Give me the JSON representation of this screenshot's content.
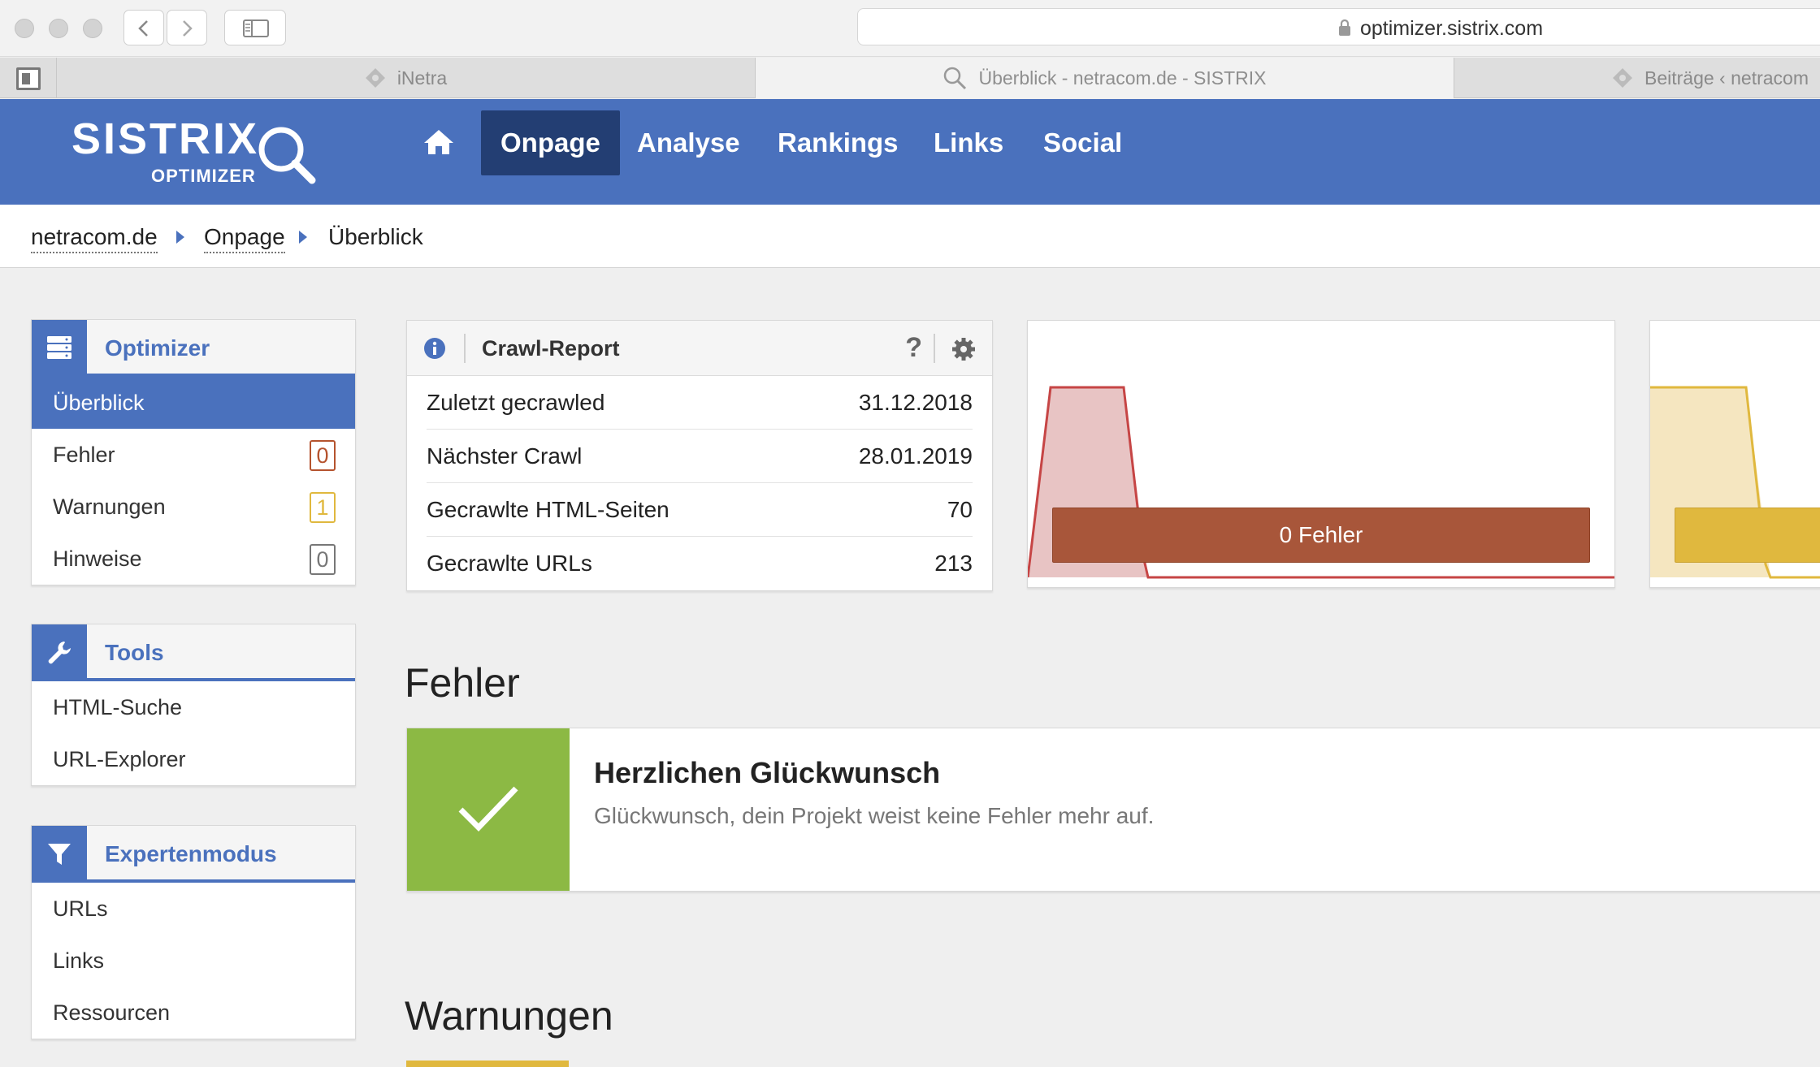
{
  "browser": {
    "url": "optimizer.sistrix.com",
    "tabs": [
      {
        "label": "iNetra",
        "icon": "diamond-favicon-icon"
      },
      {
        "label": "Überblick - netracom.de - SISTRIX",
        "icon": "search-favicon-icon"
      },
      {
        "label": "Beiträge ‹ netracom",
        "icon": "diamond-favicon-icon"
      }
    ]
  },
  "brand": {
    "name": "SISTRIX",
    "sub": "OPTIMIZER",
    "color": "#4a71bd"
  },
  "nav": {
    "home_icon": "home-icon",
    "items": [
      "Onpage",
      "Analyse",
      "Rankings",
      "Links",
      "Social"
    ],
    "active": "Onpage"
  },
  "breadcrumb": [
    "netracom.de",
    "Onpage",
    "Überblick"
  ],
  "sidebar": {
    "optimizer": {
      "title": "Optimizer",
      "icon": "server-icon",
      "items": [
        {
          "label": "Überblick"
        },
        {
          "label": "Fehler",
          "count": "0",
          "color": "#b5532e"
        },
        {
          "label": "Warnungen",
          "count": "1",
          "color": "#e0b83e"
        },
        {
          "label": "Hinweise",
          "count": "0",
          "color": "#777777"
        }
      ]
    },
    "tools": {
      "title": "Tools",
      "icon": "wrench-icon",
      "items": [
        "HTML-Suche",
        "URL-Explorer"
      ]
    },
    "expert": {
      "title": "Expertenmodus",
      "icon": "filter-icon",
      "items": [
        "URLs",
        "Links",
        "Ressourcen"
      ]
    }
  },
  "crawl_report": {
    "title": "Crawl-Report",
    "help": "?",
    "rows": [
      {
        "label": "Zuletzt gecrawled",
        "value": "31.12.2018"
      },
      {
        "label": "Nächster Crawl",
        "value": "28.01.2019"
      },
      {
        "label": "Gecrawlte HTML-Seiten",
        "value": "70"
      },
      {
        "label": "Gecrawlte URLs",
        "value": "213"
      }
    ]
  },
  "error_card": {
    "label": "0 Fehler",
    "color": "#a8563a",
    "area_color": "#e8c4c4",
    "line_color": "#c64545"
  },
  "warning_card": {
    "color": "#e0b83e",
    "area_color": "#f5e6c0",
    "line_color": "#e0b83e"
  },
  "sections": {
    "errors": {
      "title": "Fehler",
      "success_title": "Herzlichen Glückwunsch",
      "success_text": "Glückwunsch, dein Projekt weist keine Fehler mehr auf.",
      "success_color": "#8cb944"
    },
    "warnings": {
      "title": "Warnungen"
    }
  }
}
